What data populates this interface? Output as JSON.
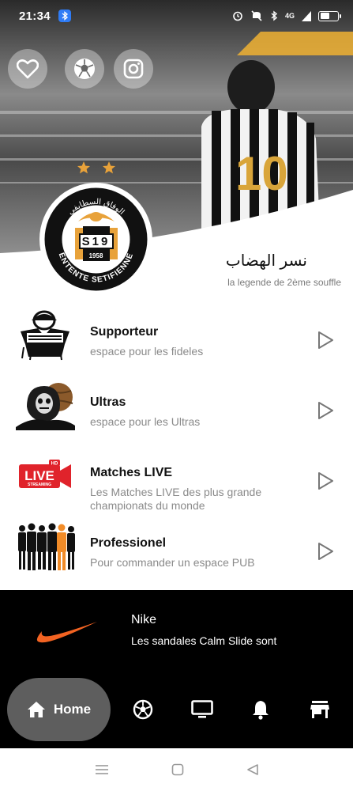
{
  "status_bar": {
    "time": "21:34",
    "network": "4G",
    "battery_level": 0.55,
    "icons": [
      "bluetooth-icon",
      "alarm-icon",
      "mute-icon",
      "bluetooth-status-icon",
      "signal-icon",
      "battery-icon"
    ]
  },
  "social": {
    "items": [
      {
        "name": "favorite",
        "icon": "heart-icon"
      },
      {
        "name": "football",
        "icon": "soccer-ball-icon"
      },
      {
        "name": "instagram",
        "icon": "instagram-icon"
      }
    ]
  },
  "club": {
    "name_ar": "نسر الهضاب",
    "tagline": "la legende de 2ème souffle",
    "crest_top_text": "الوفاق السطايفي",
    "crest_initials": "S19",
    "crest_year": "1958",
    "crest_bottom_text": "ENTENTE SETIFIENNE",
    "stars": 2,
    "accent": "#e8a23a"
  },
  "menu": {
    "items": [
      {
        "title": "Supporteur",
        "subtitle": "espace pour les fideles",
        "icon": "supporter-icon"
      },
      {
        "title": "Ultras",
        "subtitle": "espace pour les Ultras",
        "icon": "ultras-icon"
      },
      {
        "title": "Matches LIVE",
        "subtitle": "Les Matches LIVE des plus grande championats du monde",
        "icon": "live-streaming-icon",
        "icon_text": "LIVE",
        "icon_small": "STREAMING",
        "icon_badge": "HD"
      },
      {
        "title": "Professionel",
        "subtitle": "Pour commander un espace PUB",
        "icon": "professionals-icon"
      }
    ]
  },
  "promo": {
    "brand": "Nike",
    "text": "Les sandales Calm Slide sont",
    "logo_color": "#f26322"
  },
  "bottom_nav": {
    "home_label": "Home",
    "items": [
      "home-icon",
      "soccer-ball-icon",
      "tv-icon",
      "notifications-icon",
      "store-icon"
    ]
  },
  "system_nav": [
    "menu-icon",
    "home-square-icon",
    "back-icon"
  ]
}
